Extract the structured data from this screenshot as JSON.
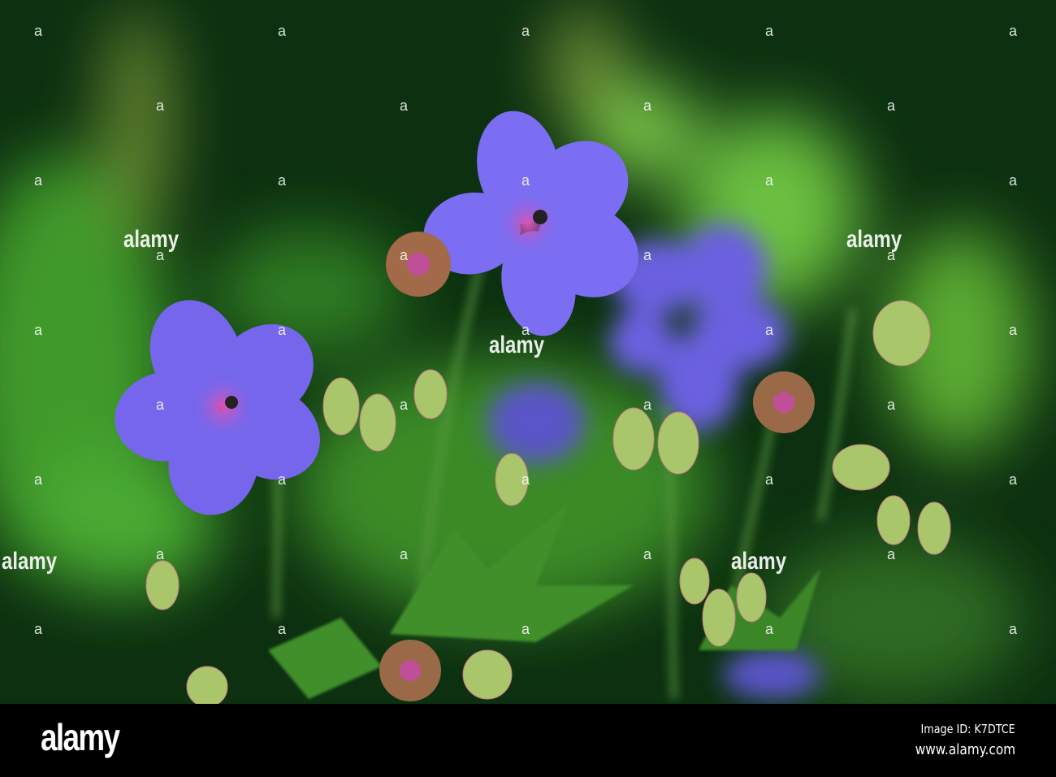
{
  "photo": {
    "subject": "geranium-flowers",
    "palette": {
      "background": "#0e3a12",
      "leaf": "#5fbf3a",
      "petal": "#7a6af0",
      "center": "#d050b0"
    }
  },
  "watermark": {
    "mark": "a",
    "text": "alamy"
  },
  "footer": {
    "logo": "alamy",
    "image_id": "Image ID: K7DTCE",
    "site": "www.alamy.com"
  }
}
